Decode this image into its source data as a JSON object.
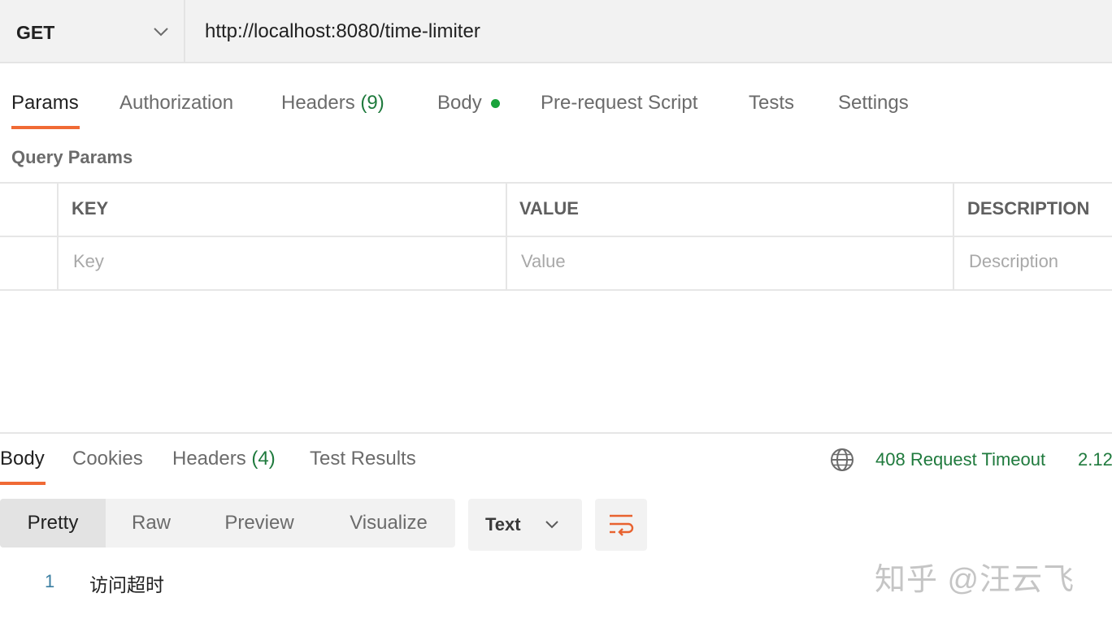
{
  "request": {
    "method": "GET",
    "url": "http://localhost:8080/time-limiter"
  },
  "request_tabs": {
    "params": "Params",
    "authorization": "Authorization",
    "headers": "Headers",
    "headers_count": "(9)",
    "body": "Body",
    "prerequest": "Pre-request Script",
    "tests": "Tests",
    "settings": "Settings"
  },
  "query_params": {
    "title": "Query Params",
    "columns": {
      "key": "KEY",
      "value": "VALUE",
      "description": "DESCRIPTION"
    },
    "placeholders": {
      "key": "Key",
      "value": "Value",
      "description": "Description"
    }
  },
  "response": {
    "tabs": {
      "body": "Body",
      "cookies": "Cookies",
      "headers": "Headers",
      "headers_count": "(4)",
      "test_results": "Test Results"
    },
    "status": "408 Request Timeout",
    "time": "2.12",
    "format_tabs": [
      "Pretty",
      "Raw",
      "Preview",
      "Visualize"
    ],
    "format_selected": "Text",
    "line_number": "1",
    "line_text": "访问超时"
  },
  "watermark": "知乎 @汪云飞",
  "colors": {
    "accent": "#f06a35",
    "status_green": "#1f7a3d",
    "body_dot": "#19a33b"
  },
  "icons": [
    "chevron-down-icon",
    "globe-icon",
    "wrap-lines-icon"
  ]
}
